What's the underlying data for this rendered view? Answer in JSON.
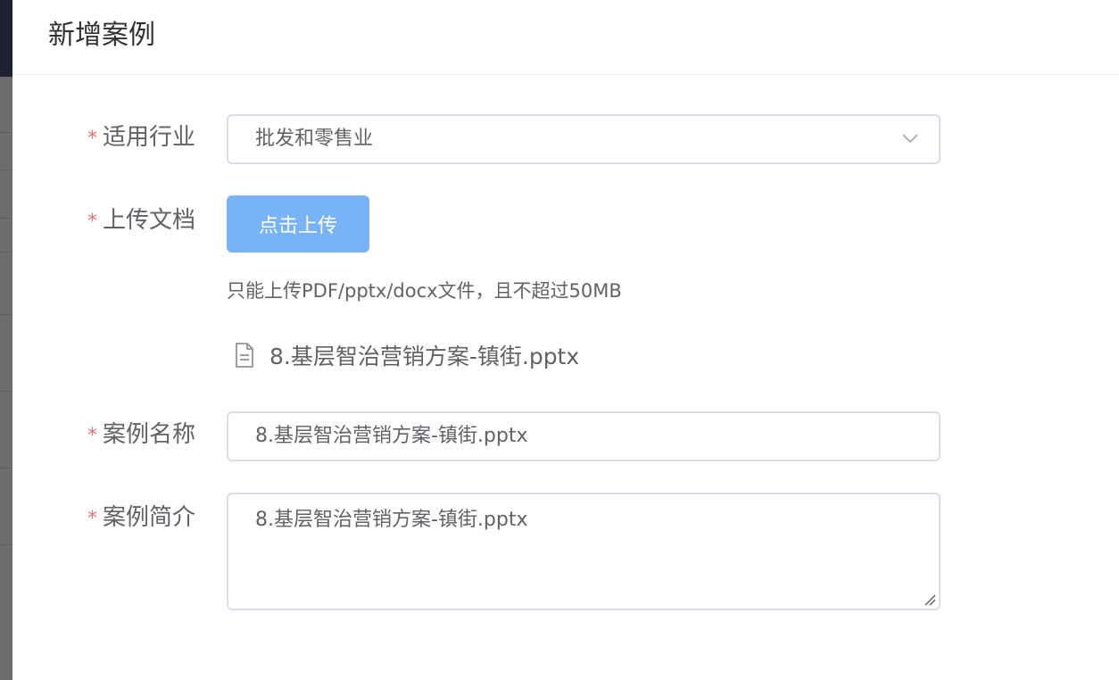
{
  "dialog": {
    "title": "新增案例"
  },
  "form": {
    "required_mark": "*",
    "industry": {
      "label": "适用行业",
      "value": "批发和零售业"
    },
    "upload": {
      "label": "上传文档",
      "button_label": "点击上传",
      "tip": "只能上传PDF/pptx/docx文件，且不超过50MB",
      "file_name": "8.基层智治营销方案-镇街.pptx",
      "file_icon": "document-icon"
    },
    "case_name": {
      "label": "案例名称",
      "value": "8.基层智治营销方案-镇街.pptx"
    },
    "case_intro": {
      "label": "案例简介",
      "value": "8.基层智治营销方案-镇街.pptx"
    }
  },
  "colors": {
    "required": "#f56c6c",
    "primary_button": "#79b3f7",
    "text": "#606266",
    "border": "#dcdfe6"
  }
}
